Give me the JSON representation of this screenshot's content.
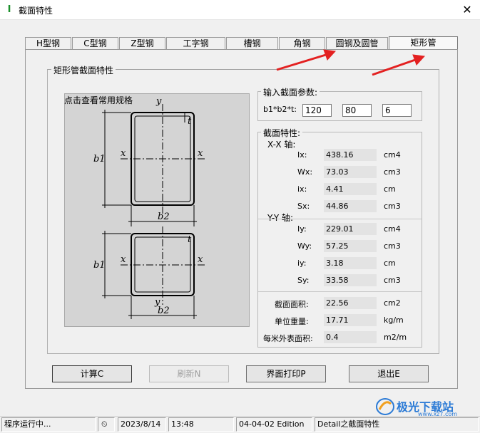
{
  "window": {
    "title": "截面特性"
  },
  "tabs": [
    {
      "label": "H型钢"
    },
    {
      "label": "C型钢"
    },
    {
      "label": "Z型钢"
    },
    {
      "label": "工字钢"
    },
    {
      "label": "槽钢"
    },
    {
      "label": "角钢"
    },
    {
      "label": "圆钢及圆管"
    },
    {
      "label": "矩形管"
    }
  ],
  "selected_tab": "矩形管",
  "group_title": "矩形管截面特性",
  "image_hint": "点击查看常用规格",
  "diagram": {
    "y": "y",
    "x": "x",
    "b1": "b1",
    "b2": "b2",
    "t": "t"
  },
  "input": {
    "title": "输入截面参数:",
    "dims_label": "b1*b2*t:",
    "b1": "120",
    "b2": "80",
    "t": "6"
  },
  "props": {
    "title": "截面特性:",
    "xx_title": "X-X 轴:",
    "yy_title": "Y-Y 轴:",
    "xx": [
      {
        "label": "Ix:",
        "value": "438.16",
        "unit": "cm4"
      },
      {
        "label": "Wx:",
        "value": "73.03",
        "unit": "cm3"
      },
      {
        "label": "ix:",
        "value": "4.41",
        "unit": "cm"
      },
      {
        "label": "Sx:",
        "value": "44.86",
        "unit": "cm3"
      }
    ],
    "yy": [
      {
        "label": "Iy:",
        "value": "229.01",
        "unit": "cm4"
      },
      {
        "label": "Wy:",
        "value": "57.25",
        "unit": "cm3"
      },
      {
        "label": "iy:",
        "value": "3.18",
        "unit": "cm"
      },
      {
        "label": "Sy:",
        "value": "33.58",
        "unit": "cm3"
      }
    ],
    "other": [
      {
        "label": "截面面积:",
        "value": "22.56",
        "unit": "cm2"
      },
      {
        "label": "单位重量:",
        "value": "17.71",
        "unit": "kg/m"
      },
      {
        "label": "每米外表面积:",
        "value": "0.4",
        "unit": "m2/m"
      }
    ]
  },
  "buttons": {
    "calc": "计算C",
    "refresh": "刷新N",
    "print": "界面打印P",
    "exit": "退出E"
  },
  "status": {
    "state": "程序运行中...",
    "date": "2023/8/14",
    "time": "13:48",
    "version": "04-04-02 Edition",
    "module": "Detail之截面特性"
  },
  "watermark": {
    "text": "极光下载站",
    "url": "www.xz7.com"
  },
  "colors": {
    "accent_arrow": "#e32020",
    "title_icon": "#1a8f2a",
    "watermark": "#2c7bd6"
  }
}
